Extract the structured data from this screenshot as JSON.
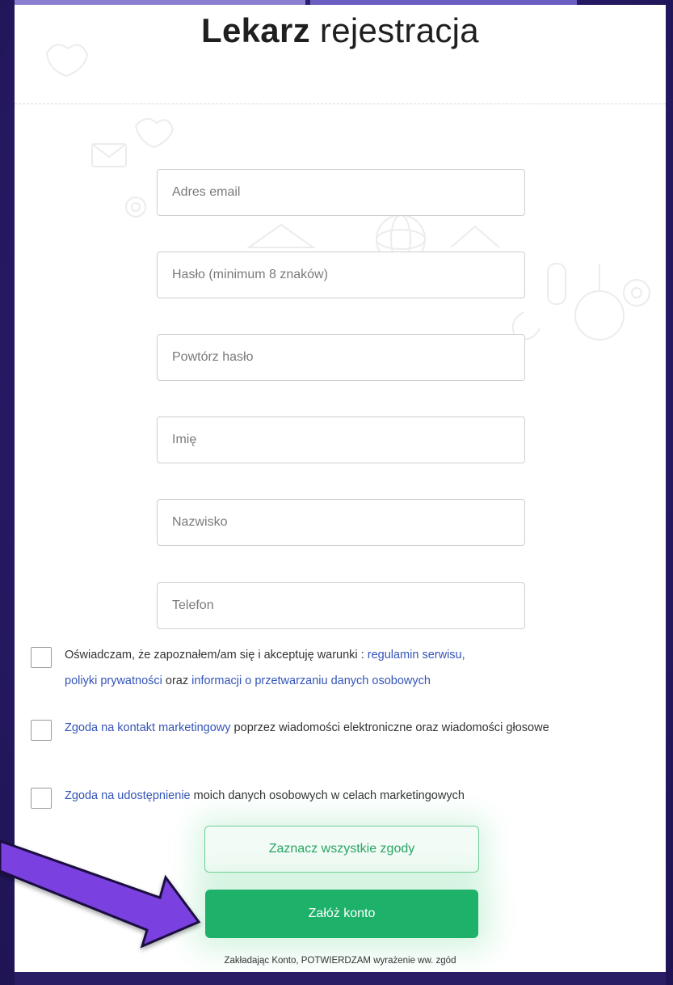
{
  "colors": {
    "background": "#2e1e6e",
    "accent_green": "#1db16a",
    "link_blue": "#3354b8",
    "arrow_purple": "#7a3fe0"
  },
  "header": {
    "title_bold": "Lekarz",
    "title_rest": "rejestracja"
  },
  "form": {
    "email_placeholder": "Adres email",
    "password_placeholder": "Hasło (minimum 8 znaków)",
    "password_repeat_placeholder": "Powtórz hasło",
    "first_name_placeholder": "Imię",
    "last_name_placeholder": "Nazwisko",
    "phone_placeholder": "Telefon"
  },
  "consents": {
    "terms": {
      "text_before": "Oświadczam, że zapoznałem/am się i akceptuję warunki : ",
      "link_terms": "regulamin serwisu,",
      "link_privacy": "poliyki prywatności",
      "text_and": " oraz ",
      "link_data": "informacji o przetwarzaniu danych osobowych"
    },
    "marketing": {
      "link": "Zgoda na kontakt marketingowy",
      "text": " poprzez wiadomości elektroniczne oraz wiadomości głosowe"
    },
    "sharing": {
      "link": "Zgoda na udostępnienie",
      "text": " moich danych osobowych w celach marketingowych"
    }
  },
  "buttons": {
    "select_all": "Zaznacz wszystkie zgody",
    "create_account": "Załóż konto"
  },
  "footer": {
    "note": "Zakładając Konto, POTWIERDZAM wyrażenie ww. zgód"
  }
}
